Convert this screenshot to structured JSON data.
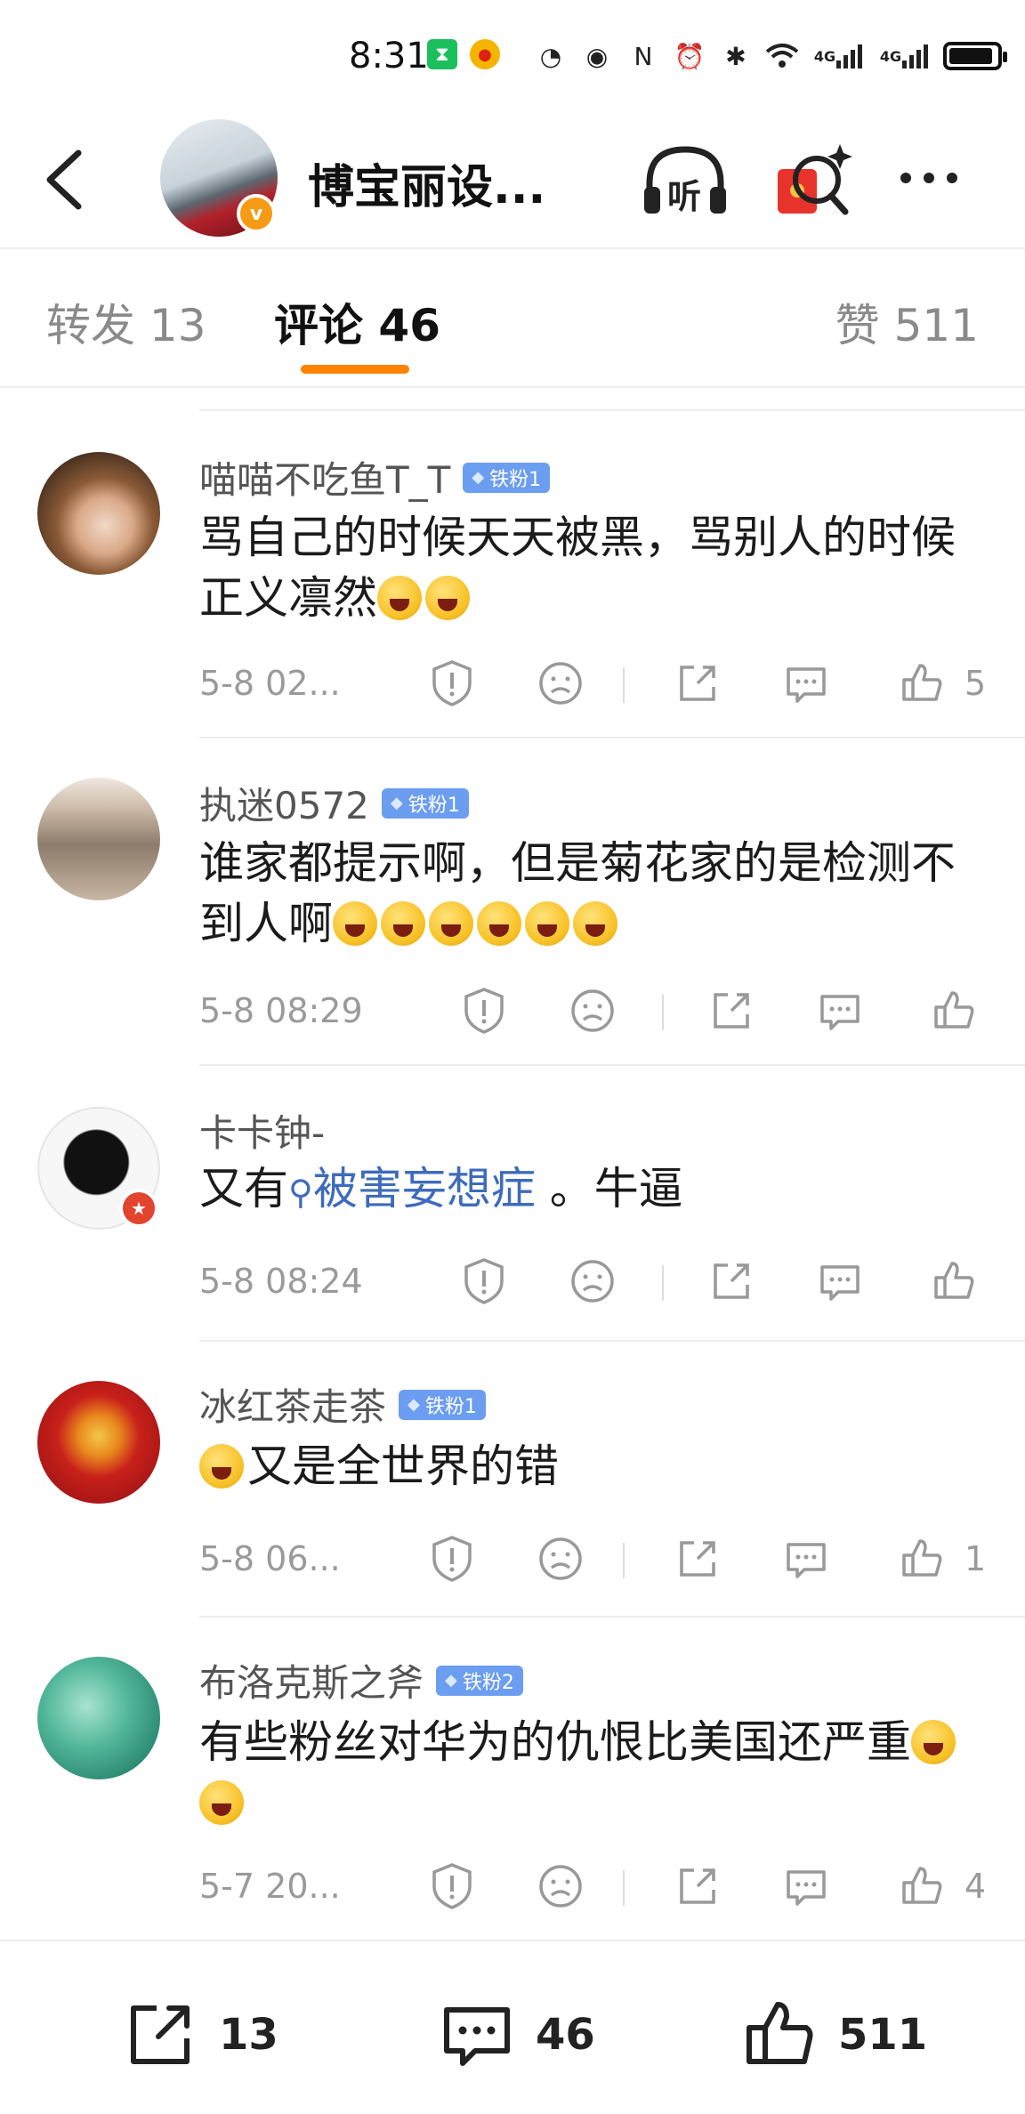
{
  "status_bar": {
    "time": "8:31",
    "network_1": "4G",
    "network_2": "4G"
  },
  "header": {
    "title": "博宝丽设...",
    "listen_label": "听"
  },
  "tabs": {
    "repost": "转发 13",
    "comment": "评论 46",
    "like": "赞 511"
  },
  "comments": [
    {
      "name": "喵喵不吃鱼T_T",
      "badge": "铁粉1",
      "text": "骂自己的时候天天被黑，骂别人的时候正义凛然",
      "emoji_count": 2,
      "time": "5-8 02...",
      "likes": "5"
    },
    {
      "name": "执迷0572",
      "badge": "铁粉1",
      "text": "谁家都提示啊，但是菊花家的是检测不到人啊",
      "emoji_count": 6,
      "time": "5-8 08:29",
      "likes": ""
    },
    {
      "name": "卡卡钟-",
      "badge": "",
      "text_prefix": "又有",
      "topic": "被害妄想症",
      "text_suffix": " 。牛逼",
      "time": "5-8 08:24",
      "likes": ""
    },
    {
      "name": "冰红茶走茶",
      "badge": "铁粉1",
      "text": "又是全世界的错",
      "emoji_count": 1,
      "time": "5-8 06...",
      "likes": "1"
    },
    {
      "name": "布洛克斯之斧",
      "badge": "铁粉2",
      "text": "有些粉丝对华为的仇恨比美国还严重",
      "emoji_count": 2,
      "time": "5-7 20...",
      "likes": "4"
    }
  ],
  "bottom_bar": {
    "repost_count": "13",
    "comment_count": "46",
    "like_count": "511"
  },
  "colors": {
    "accent": "#ff8200",
    "badge": "#6b9df0",
    "link": "#3e6bbb"
  }
}
